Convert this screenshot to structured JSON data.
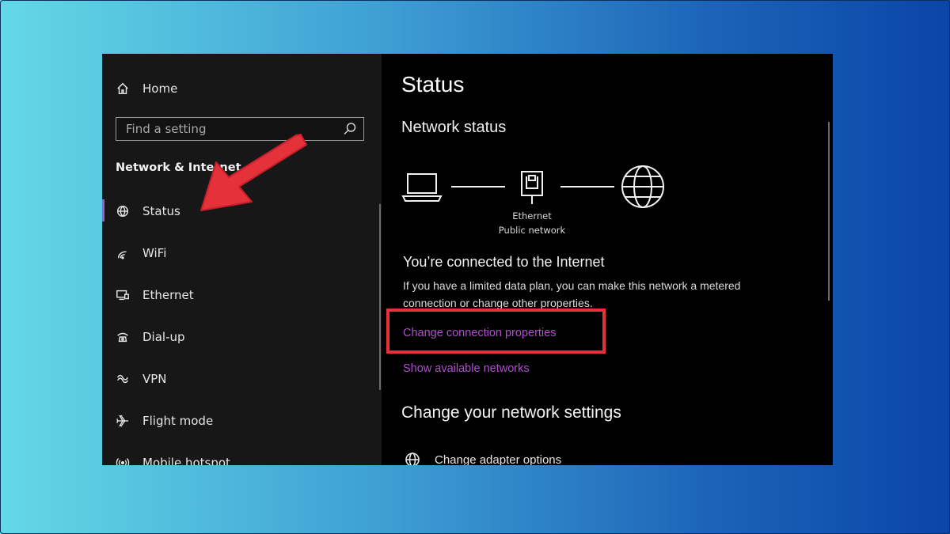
{
  "sidebar": {
    "home_label": "Home",
    "search_placeholder": "Find a setting",
    "section_title": "Network & Internet",
    "items": [
      {
        "label": "Status",
        "icon": "globe-status-icon"
      },
      {
        "label": "WiFi",
        "icon": "wifi-icon"
      },
      {
        "label": "Ethernet",
        "icon": "ethernet-icon"
      },
      {
        "label": "Dial-up",
        "icon": "dial-up-icon"
      },
      {
        "label": "VPN",
        "icon": "vpn-icon"
      },
      {
        "label": "Flight mode",
        "icon": "airplane-icon"
      },
      {
        "label": "Mobile hotspot",
        "icon": "hotspot-icon"
      }
    ],
    "active_item": "Status"
  },
  "main": {
    "title": "Status",
    "network_status_heading": "Network status",
    "diagram": {
      "adapter_name": "Ethernet",
      "network_type": "Public network"
    },
    "connected_heading": "You’re connected to the Internet",
    "description": "If you have a limited data plan, you can make this network a metered connection or change other properties.",
    "change_connection_link": "Change connection properties",
    "show_networks_link": "Show available networks",
    "change_settings_heading": "Change your network settings",
    "adapter_options_label": "Change adapter options"
  },
  "colors": {
    "background_gradient_start": "#63d9e6",
    "background_gradient_end": "#0a45a8",
    "accent_link": "#b04fcc",
    "active_indicator": "#a35bd6",
    "annotation_red": "#e5313a"
  }
}
